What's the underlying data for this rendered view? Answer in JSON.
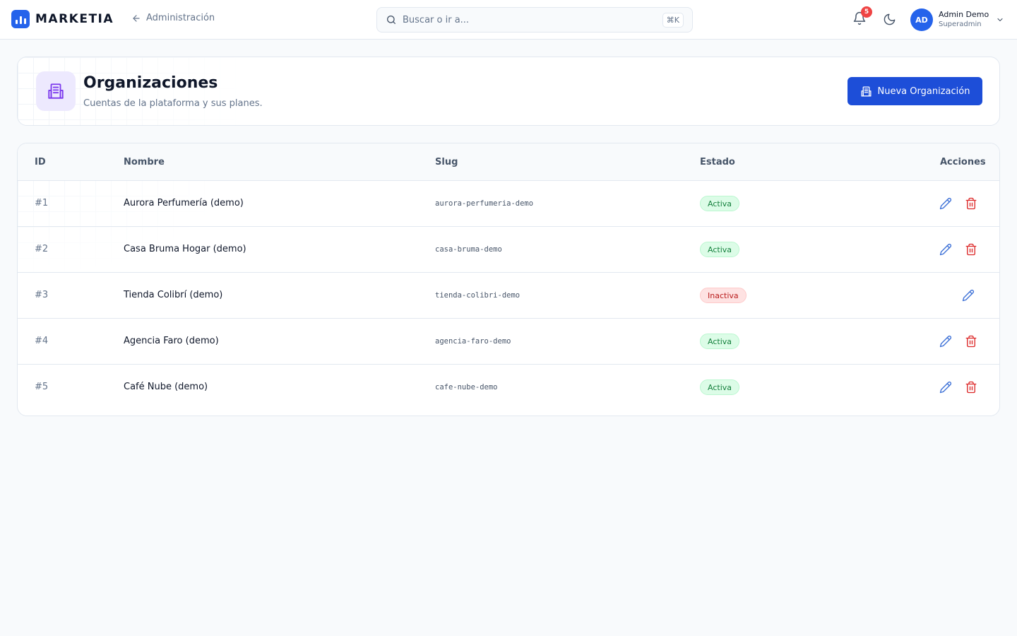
{
  "brand": {
    "name": "MARKETIA"
  },
  "nav": {
    "back_label": "Administración"
  },
  "search": {
    "placeholder": "Buscar o ir a...",
    "shortcut": "⌘K"
  },
  "notifications": {
    "count": "5"
  },
  "user": {
    "initials": "AD",
    "name": "Admin Demo",
    "role": "Superadmin"
  },
  "page": {
    "title": "Organizaciones",
    "subtitle": "Cuentas de la plataforma y sus planes.",
    "new_button": "Nueva Organización"
  },
  "table": {
    "columns": {
      "id": "ID",
      "name": "Nombre",
      "slug": "Slug",
      "status": "Estado",
      "actions": "Acciones"
    },
    "rows": [
      {
        "id": "#1",
        "name": "Aurora Perfumería (demo)",
        "slug": "aurora-perfumeria-demo",
        "status": "Activa",
        "active": true
      },
      {
        "id": "#2",
        "name": "Casa Bruma Hogar (demo)",
        "slug": "casa-bruma-demo",
        "status": "Activa",
        "active": true
      },
      {
        "id": "#3",
        "name": "Tienda Colibrí (demo)",
        "slug": "tienda-colibri-demo",
        "status": "Inactiva",
        "active": false
      },
      {
        "id": "#4",
        "name": "Agencia Faro (demo)",
        "slug": "agencia-faro-demo",
        "status": "Activa",
        "active": true
      },
      {
        "id": "#5",
        "name": "Café Nube (demo)",
        "slug": "cafe-nube-demo",
        "status": "Activa",
        "active": true
      }
    ]
  },
  "colors": {
    "primary": "#1d4ed8",
    "active_badge": "#15803d",
    "inactive_badge": "#b91c1c",
    "edit_icon": "#3b6fd6",
    "delete_icon": "#dc2626"
  }
}
